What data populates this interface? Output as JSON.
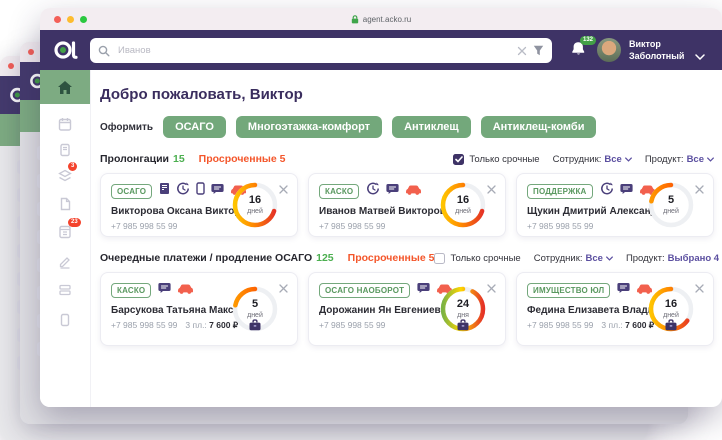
{
  "browser": {
    "url": "agent.acko.ru"
  },
  "header": {
    "search_placeholder": "Иванов",
    "notifications_badge": "132",
    "user_first_name": "Виктор",
    "user_last_name": "Заболотный"
  },
  "welcome": {
    "title": "Добро пожаловать, Виктор"
  },
  "issue": {
    "label": "Оформить",
    "buttons": [
      "ОСАГО",
      "Многоэтажка-комфорт",
      "Антиклещ",
      "Антиклещ-комби"
    ]
  },
  "sidebar": {
    "layers_badge": "3",
    "calculator_badge": "23"
  },
  "sections": [
    {
      "title": "Пролонгации",
      "count": "15",
      "overdue": "Просроченные 5",
      "only_urgent_label": "Только срочные",
      "only_urgent_checked": true,
      "employee_label": "Сотрудник:",
      "employee_value": "Все",
      "product_label": "Продукт:",
      "product_value": "Все",
      "cards": [
        {
          "badge": "ОСАГО",
          "icons": [
            "receipt-icon",
            "history-icon",
            "mobile-icon",
            "chat-icon",
            "car-icon"
          ],
          "name": "Викторова Оксана Викторо...",
          "phone": "+7 985 998 55 99",
          "days": "16",
          "days_unit": "дней",
          "gauge": {
            "percent": 70,
            "colors": [
              "#e53226",
              "#ff8a00",
              "#ffc400"
            ]
          }
        },
        {
          "badge": "КАСКО",
          "icons": [
            "history-icon",
            "chat-icon",
            "car-icon"
          ],
          "name": "Иванов Матвей Викторови...",
          "phone": "+7 985 998 55 99",
          "days": "16",
          "days_unit": "дней",
          "gauge": {
            "percent": 70,
            "colors": [
              "#e53226",
              "#ff8a00",
              "#ffc400"
            ]
          }
        },
        {
          "badge": "ПОДДЕРЖКА",
          "icons": [
            "history-icon",
            "chat-icon",
            "car-icon"
          ],
          "name": "Щукин Дмитрий Александ...",
          "phone": "+7 985 998 55 99",
          "days": "5",
          "days_unit": "дней",
          "gauge": {
            "percent": 22,
            "colors": [
              "#e53226",
              "#ff6a00",
              "#ff9800"
            ]
          }
        }
      ]
    },
    {
      "title": "Очередные платежи / продление ОСАГО",
      "count": "125",
      "overdue": "Просроченные 5",
      "only_urgent_label": "Только срочные",
      "only_urgent_checked": false,
      "employee_label": "Сотрудник:",
      "employee_value": "Все",
      "product_label": "Продукт:",
      "product_value": "Выбрано 4",
      "cards": [
        {
          "badge": "КАСКО",
          "icons": [
            "chat-icon",
            "car-icon"
          ],
          "name": "Барсукова Татьяна Макси...",
          "phone": "+7 985 998 55 99",
          "payments_label": "3 пл.:",
          "payments_value": "7 600 ₽",
          "days": "5",
          "days_unit": "дней",
          "gauge": {
            "percent": 22,
            "colors": [
              "#e53226",
              "#ff6a00",
              "#ff9800"
            ]
          }
        },
        {
          "badge": "ОСАГО НАОБОРОТ",
          "icons": [
            "chat-icon",
            "car-icon"
          ],
          "name": "Дорожанин Ян Евгениевич",
          "phone": "+7 985 998 55 99",
          "days": "24",
          "days_unit": "дня",
          "gauge": {
            "percent": 92,
            "colors": [
              "#e53226",
              "#ffd600",
              "#7cb342"
            ]
          }
        },
        {
          "badge": "ИМУЩЕСТВО ЮЛ",
          "icons": [
            "chat-icon",
            "car-icon"
          ],
          "name": "Федина Елизавета Владим...",
          "phone": "+7 985 998 55 99",
          "payments_label": "3 пл.:",
          "payments_value": "7 600 ₽",
          "days": "16",
          "days_unit": "дней",
          "gauge": {
            "percent": 65,
            "colors": [
              "#e53226",
              "#ff8a00",
              "#ffc400"
            ]
          }
        }
      ]
    }
  ],
  "colors": {
    "header_purple": "#3e3366",
    "brand_green": "#73a87b",
    "count_green": "#4caf50",
    "overdue_orange": "#f4562b",
    "alert_red": "#e53226",
    "notification_green": "#43a047"
  }
}
